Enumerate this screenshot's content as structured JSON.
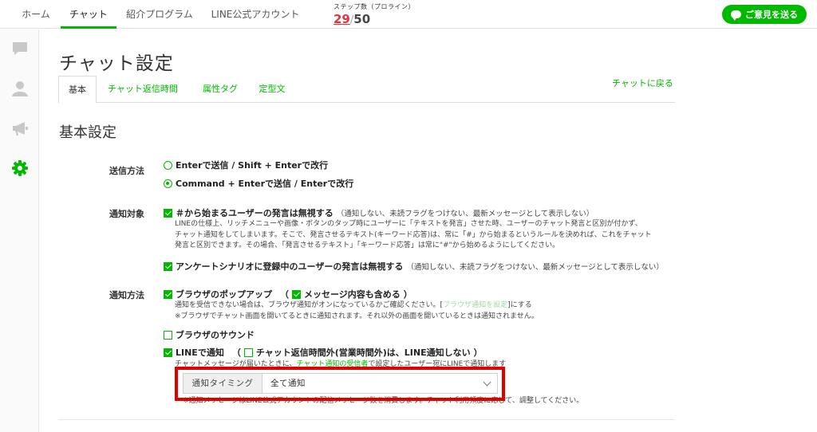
{
  "topnav": {
    "tabs": [
      {
        "label": "ホーム"
      },
      {
        "label": "チャット"
      },
      {
        "label": "紹介プログラム"
      },
      {
        "label": "LINE公式アカウント"
      }
    ],
    "step_label": "ステップ数（プロライン）",
    "step_used": "29",
    "step_sep": "/",
    "step_total": "50",
    "feedback": "ご意見を送る"
  },
  "sidebar": {
    "icons": [
      "chat-bubble-icon",
      "user-icon",
      "megaphone-icon",
      "gear-icon"
    ]
  },
  "page": {
    "title": "チャット設定",
    "tabs": [
      {
        "label": "基本"
      },
      {
        "label": "チャット返信時間"
      },
      {
        "label": "属性タグ"
      },
      {
        "label": "定型文"
      }
    ],
    "back_link": "チャットに戻る",
    "section_title": "基本設定"
  },
  "send_method": {
    "label": "送信方法",
    "option1": "Enterで送信 / Shift + Enterで改行",
    "option2": "Command + Enterで送信 / Enterで改行"
  },
  "notify_target": {
    "label": "通知対象",
    "option1": "＃から始まるユーザーの発言は無視する",
    "option1_note": "（通知しない、未読フラグをつけない、最新メッセージとして表示しない）",
    "desc1": "LINEの仕様上、リッチメニューや画像・ボタンのタップ時にユーザーに「テキストを発言」させた時、ユーザーのチャット発言と区別が付かず、",
    "desc2": "チャット通知をしてしまいます。そこで、発言させるテキスト(キーワード応答)は、常に「#」から始まるというルールを決めれば、これをチャット",
    "desc3": "発言と区別できます。その場合、「発言させるテキスト」「キーワード応答」は常に\"#\"から始めるようにしてください。",
    "option2": "アンケートシナリオに登録中のユーザーの発言は無視する",
    "option2_note": "（通知しない、未読フラグをつけない、最新メッセージとして表示しない）"
  },
  "notify_method": {
    "label": "通知方法",
    "browser_popup": "ブラウザのポップアップ",
    "paren_open": "（",
    "include_content": "メッセージ内容も含める",
    "paren_close": "）",
    "popup_desc1_a": "通知を受信できない場合は、ブラウザ通知がオンになっているかご確認ください。[",
    "popup_desc1_link": "ブラウザ通知を設定",
    "popup_desc1_b": "]にする",
    "popup_desc2": "※ブラウザでチャット画面を開いてるときに通知されます。それ以外の画面を開いているときは通知されません。",
    "browser_sound": "ブラウザのサウンド",
    "line_notify": "LINEで通知",
    "line_paren_open": "（",
    "outside_hours": "チャット返信時間外(営業時間外)は、LINE通知しない",
    "line_paren_close": "）",
    "line_desc_a": "チャットメッセージが届いたときに、",
    "line_desc_link": "チャット通知の受信者",
    "line_desc_b": "で設定したユーザー宛にLINEで通知します",
    "timing_label": "通知タイミング",
    "timing_value": "全て通知",
    "note": "※通知メッセージはLINE公式アカウントの配信メッセージ数を消費します。チャット利用頻度に応じて、調整してください。"
  },
  "colors": {
    "accent": "#00b900",
    "highlight": "#e10000",
    "step_used": "#e2343f"
  }
}
